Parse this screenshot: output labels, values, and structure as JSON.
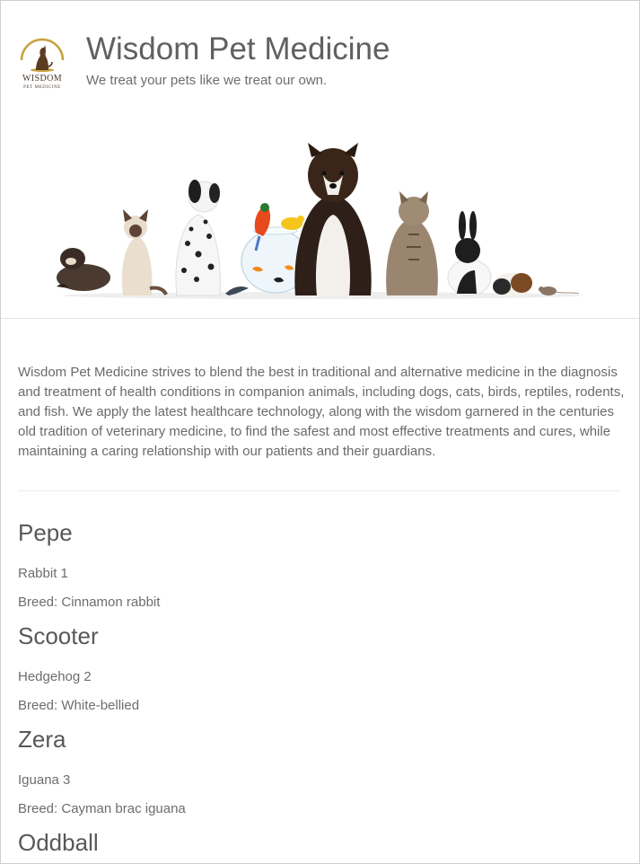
{
  "header": {
    "logo_text": "WISDOM",
    "logo_subtext": "PET MEDICINE",
    "title": "Wisdom Pet Medicine",
    "tagline": "We treat your pets like we treat our own."
  },
  "intro": "Wisdom Pet Medicine strives to blend the best in traditional and alternative medicine in the diagnosis and treatment of health conditions in companion animals, including dogs, cats, birds, reptiles, rodents, and fish. We apply the latest healthcare technology, along with the wisdom garnered in the centuries old tradition of veterinary medicine, to find the safest and most effective treatments and cures, while maintaining a caring relationship with our patients and their guardians.",
  "pets": [
    {
      "name": "Pepe",
      "species_line": "Rabbit 1",
      "breed_line": "Breed: Cinnamon rabbit"
    },
    {
      "name": "Scooter",
      "species_line": "Hedgehog 2",
      "breed_line": "Breed: White-bellied"
    },
    {
      "name": "Zera",
      "species_line": "Iguana 3",
      "breed_line": "Breed: Cayman brac iguana"
    },
    {
      "name": "Oddball"
    }
  ],
  "colors": {
    "logo_gold": "#c9a13b",
    "logo_brown": "#5a3d1e",
    "text": "#606060"
  }
}
